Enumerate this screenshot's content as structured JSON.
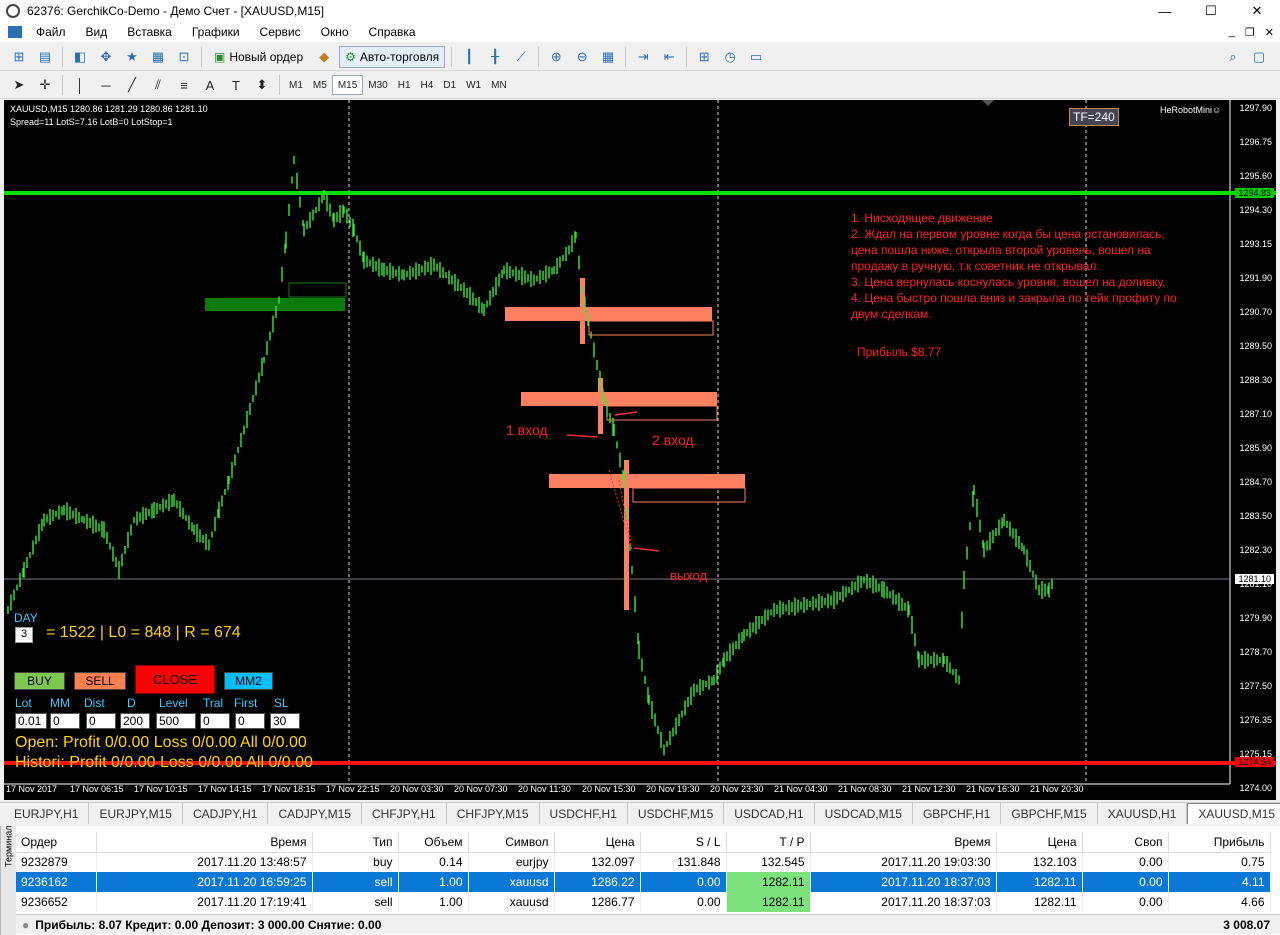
{
  "window": {
    "title": "62376: GerchikCo-Demo - Демо Счет - [XAUUSD,M15]",
    "min": "—",
    "max": "☐",
    "close": "✕"
  },
  "menu": [
    "Файл",
    "Вид",
    "Вставка",
    "Графики",
    "Сервис",
    "Окно",
    "Справка"
  ],
  "toolbar": {
    "new_order": "Новый ордер",
    "autotrade": "Авто-торговля"
  },
  "timeframes": [
    "M1",
    "M5",
    "M15",
    "M30",
    "H1",
    "H4",
    "D1",
    "W1",
    "MN"
  ],
  "active_timeframe": "M15",
  "chart": {
    "symbol_line": "XAUUSD,M15  1280.86 1281.29 1280.86 1281.10",
    "spread_line": "Spread=11  LotS=7.16  LotB=0  LotStop=1",
    "tf_badge": "TF=240",
    "robot": "HeRobotMini☺",
    "price_axis": [
      "1297.90",
      "1296.75",
      "1295.60",
      "1294.30",
      "1293.15",
      "1291.90",
      "1290.70",
      "1289.50",
      "1288.30",
      "1287.10",
      "1285.90",
      "1284.70",
      "1283.50",
      "1282.30",
      "1281.10",
      "1279.90",
      "1278.70",
      "1277.50",
      "1276.35",
      "1275.15",
      "1274.00"
    ],
    "green_level": "1294.83",
    "red_level": "1274.54",
    "current_price": "1281.10",
    "time_axis": [
      "17 Nov 2017",
      "17 Nov 06:15",
      "17 Nov 10:15",
      "17 Nov 14:15",
      "17 Nov 18:15",
      "17 Nov 22:15",
      "20 Nov 03:30",
      "20 Nov 07:30",
      "20 Nov 11:30",
      "20 Nov 15:30",
      "20 Nov 19:30",
      "20 Nov 23:30",
      "21 Nov 04:30",
      "21 Nov 08:30",
      "21 Nov 12:30",
      "21 Nov 16:30",
      "21 Nov 20:30"
    ],
    "annotations": [
      "1. Нисходящее движение",
      "2. Ждал на первом уровне когда бы цена остановилась,",
      "цена пошла ниже, открыла второй уровень, вошел на",
      "продажу в ручную, т.к советник не открывал.",
      "3. Цена вернулась коснулась уровня, вошел на доливку.",
      "4. Цена быстро пошла вниз и закрыла по тейк профиту по",
      "двум сделкам."
    ],
    "profit_note": "Прибыль $8.77",
    "entry1": "1 вход",
    "entry2": "2 вход",
    "exit": "выход",
    "panel": {
      "day_label": "DAY",
      "day_value": "3",
      "stats": "= 1522 | L0 = 848 | R = 674",
      "buy": "BUY",
      "sell": "SELL",
      "close": "CLOSE",
      "mm2": "MM2",
      "labels": [
        "Lot",
        "MM",
        "Dist",
        "D",
        "Level",
        "Tral",
        "First",
        "SL"
      ],
      "values": [
        "0.01",
        "0",
        "0",
        "200",
        "500",
        "0",
        "0",
        "30"
      ],
      "open_line": "Open:  Profit 0/0.00  Loss 0/0.00  All 0/0.00",
      "history_line": "Histori: Profit 0/0.00  Loss 0/0.00  All 0/0.00"
    }
  },
  "tabs": [
    "EURJPY,H1",
    "EURJPY,M15",
    "CADJPY,H1",
    "CADJPY,M15",
    "CHFJPY,H1",
    "CHFJPY,M15",
    "USDCHF,H1",
    "USDCHF,M15",
    "USDCAD,H1",
    "USDCAD,M15",
    "GBPCHF,H1",
    "GBPCHF,M15",
    "XAUUSD,H1",
    "XAUUSD,M15"
  ],
  "active_tab": "XAUUSD,M15",
  "terminal": {
    "side_label": "Терминал",
    "columns": [
      "Ордер",
      "Время",
      "Тип",
      "Объем",
      "Символ",
      "Цена",
      "S / L",
      "T / P",
      "Время",
      "Цена",
      "Своп",
      "Прибыль"
    ],
    "rows": [
      [
        "9232879",
        "2017.11.20 13:48:57",
        "buy",
        "0.14",
        "eurjpy",
        "132.097",
        "131.848",
        "132.545",
        "2017.11.20 19:03:30",
        "132.103",
        "0.00",
        "0.75"
      ],
      [
        "9236162",
        "2017.11.20 16:59:25",
        "sell",
        "1.00",
        "xauusd",
        "1286.22",
        "0.00",
        "1282.11",
        "2017.11.20 18:37:03",
        "1282.11",
        "0.00",
        "4.11"
      ],
      [
        "9236652",
        "2017.11.20 17:19:41",
        "sell",
        "1.00",
        "xauusd",
        "1286.77",
        "0.00",
        "1282.11",
        "2017.11.20 18:37:03",
        "1282.11",
        "0.00",
        "4.66"
      ]
    ],
    "footer": "Прибыль: 8.07  Кредит: 0.00  Депозит: 3 000.00  Снятие: 0.00",
    "footer_total": "3 008.07"
  }
}
